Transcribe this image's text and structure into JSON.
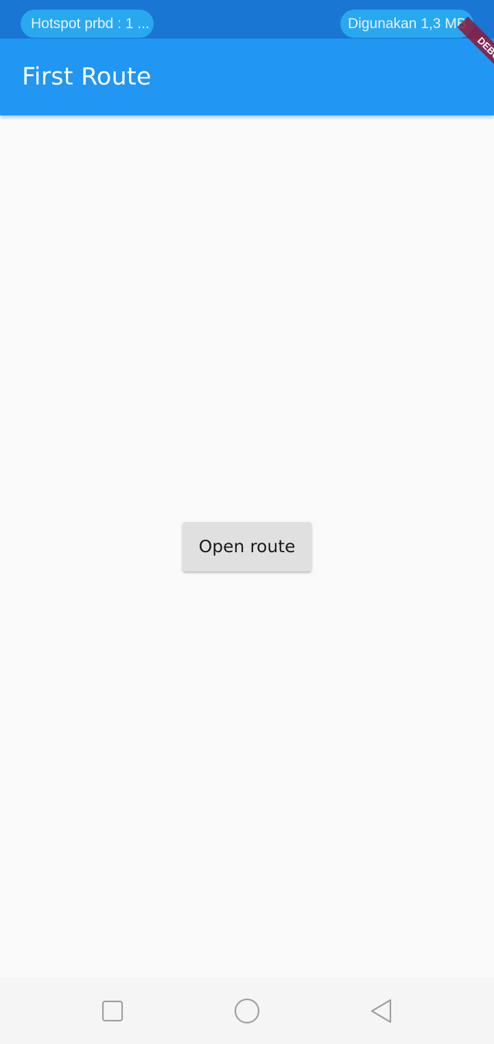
{
  "status_bar": {
    "left_pill": "Hotspot prbd : 1 ...",
    "right_pill": "Digunakan 1,3 MB",
    "background_color": "#1976d2",
    "pill_color": "#29a8f0"
  },
  "app_bar": {
    "title": "First Route",
    "color": "#2196f3"
  },
  "debug_banner": {
    "label": "DEBUG",
    "color": "#8b1a3a"
  },
  "main": {
    "button_label": "Open route"
  },
  "nav_bar": {
    "recents_icon": "square-icon",
    "home_icon": "circle-icon",
    "back_icon": "triangle-back-icon"
  }
}
